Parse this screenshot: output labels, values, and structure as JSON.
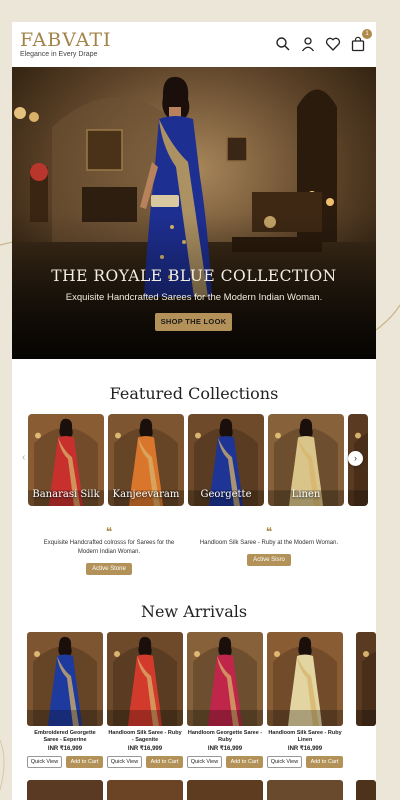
{
  "brand": {
    "name": "FABVATI",
    "tagline": "Elegance in Every Drape"
  },
  "header": {
    "cart_count": "1",
    "icons": [
      "search-icon",
      "user-icon",
      "heart-icon",
      "bag-icon"
    ]
  },
  "hero": {
    "title": "THE ROYALE BLUE COLLECTION",
    "subtitle": "Exquisite Handcrafted Sarees for the Modern Indian Woman.",
    "cta": "SHOP THE LOOK"
  },
  "featured": {
    "title": "Featured Collections",
    "items": [
      {
        "label": "Banarasi Silk",
        "saree": "#c8302e"
      },
      {
        "label": "Kanjeevaram",
        "saree": "#d9762c"
      },
      {
        "label": "Georgette",
        "saree": "#1e3596"
      },
      {
        "label": "Linen",
        "saree": "#d9c58a"
      },
      {
        "label": "",
        "saree": "#7a2b1e"
      }
    ]
  },
  "testimonials": [
    {
      "text": "Exquisite Handcrafted colrosss for Sarees for the Modern Indian Woman.",
      "button": "Active Stone"
    },
    {
      "text": "Handloom Silk Saree - Ruby at the Modern Woman.",
      "button": "Active Sisro"
    }
  ],
  "new_arrivals": {
    "title": "New Arrivals",
    "quick_view": "Quick View",
    "add_to_cart": "Add to Cart",
    "items": [
      {
        "name": "Embroidered Georgette Saree - Eeperine",
        "price": "INR ₹16,999",
        "saree": "#1f3a9e"
      },
      {
        "name": "Handloom Silk Saree - Ruby - Sagenite",
        "price": "INR ₹16,999",
        "saree": "#d23a2c"
      },
      {
        "name": "Handloom Georgette Saree - Ruby",
        "price": "INR ₹16,999",
        "saree": "#c0254a"
      },
      {
        "name": "Handloom Silk Saree - Ruby Linen",
        "price": "INR ₹16,999",
        "saree": "#e3d5a2"
      }
    ]
  }
}
